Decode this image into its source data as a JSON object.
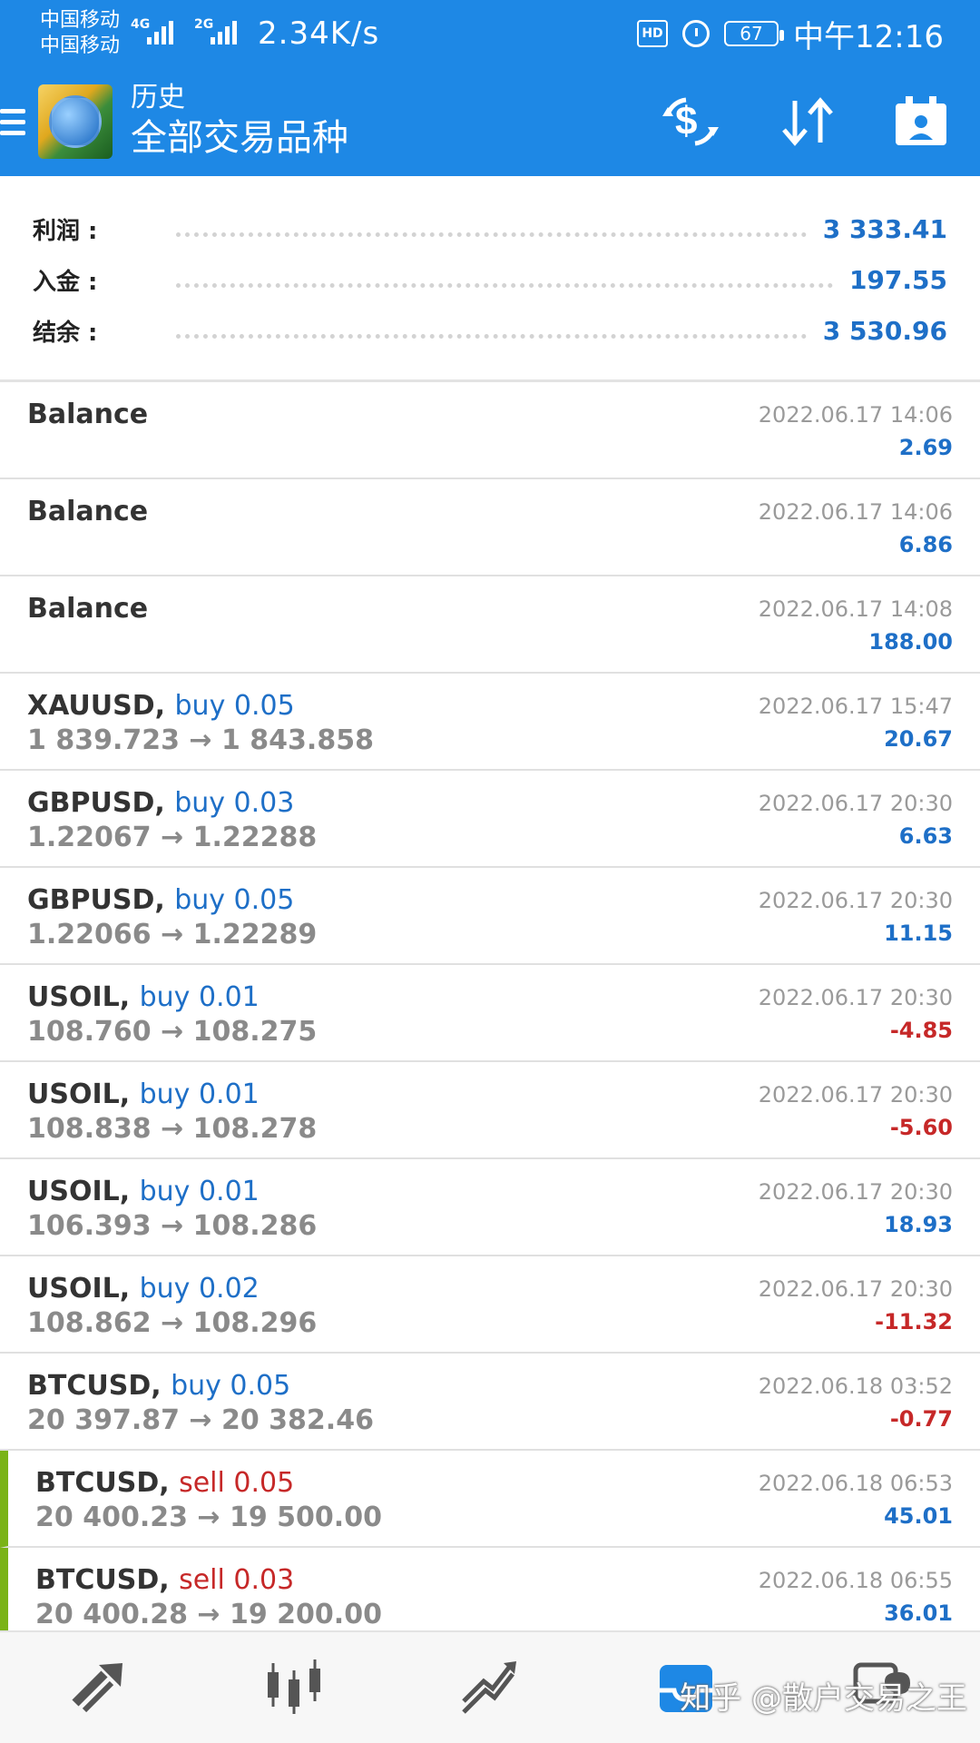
{
  "status_bar": {
    "carrier1": "中国移动",
    "carrier2": "中国移动",
    "sig1_tag": "4G",
    "sig2_tag": "2G",
    "netspeed": "2.34K/s",
    "hd": "HD",
    "battery": "67",
    "time": "中午12:16"
  },
  "appbar": {
    "subtitle": "历史",
    "title": "全部交易品种"
  },
  "summary": {
    "rows": [
      {
        "label": "利润 :",
        "value": "3 333.41"
      },
      {
        "label": "入金 :",
        "value": "197.55"
      },
      {
        "label": "结余 :",
        "value": "3 530.96"
      }
    ]
  },
  "deals": [
    {
      "symbol": "Balance",
      "side": "",
      "prices": "",
      "date": "2022.06.17 14:06",
      "profit": "2.69",
      "sign": "pos",
      "accent": false
    },
    {
      "symbol": "Balance",
      "side": "",
      "prices": "",
      "date": "2022.06.17 14:06",
      "profit": "6.86",
      "sign": "pos",
      "accent": false
    },
    {
      "symbol": "Balance",
      "side": "",
      "prices": "",
      "date": "2022.06.17 14:08",
      "profit": "188.00",
      "sign": "pos",
      "accent": false
    },
    {
      "symbol": "XAUUSD,",
      "side": "buy 0.05",
      "side_type": "buy",
      "prices": "1 839.723 → 1 843.858",
      "date": "2022.06.17 15:47",
      "profit": "20.67",
      "sign": "pos",
      "accent": false
    },
    {
      "symbol": "GBPUSD,",
      "side": "buy 0.03",
      "side_type": "buy",
      "prices": "1.22067 → 1.22288",
      "date": "2022.06.17 20:30",
      "profit": "6.63",
      "sign": "pos",
      "accent": false
    },
    {
      "symbol": "GBPUSD,",
      "side": "buy 0.05",
      "side_type": "buy",
      "prices": "1.22066 → 1.22289",
      "date": "2022.06.17 20:30",
      "profit": "11.15",
      "sign": "pos",
      "accent": false
    },
    {
      "symbol": "USOIL,",
      "side": "buy 0.01",
      "side_type": "buy",
      "prices": "108.760 → 108.275",
      "date": "2022.06.17 20:30",
      "profit": "-4.85",
      "sign": "neg",
      "accent": false
    },
    {
      "symbol": "USOIL,",
      "side": "buy 0.01",
      "side_type": "buy",
      "prices": "108.838 → 108.278",
      "date": "2022.06.17 20:30",
      "profit": "-5.60",
      "sign": "neg",
      "accent": false
    },
    {
      "symbol": "USOIL,",
      "side": "buy 0.01",
      "side_type": "buy",
      "prices": "106.393 → 108.286",
      "date": "2022.06.17 20:30",
      "profit": "18.93",
      "sign": "pos",
      "accent": false
    },
    {
      "symbol": "USOIL,",
      "side": "buy 0.02",
      "side_type": "buy",
      "prices": "108.862 → 108.296",
      "date": "2022.06.17 20:30",
      "profit": "-11.32",
      "sign": "neg",
      "accent": false
    },
    {
      "symbol": "BTCUSD,",
      "side": "buy 0.05",
      "side_type": "buy",
      "prices": "20 397.87 → 20 382.46",
      "date": "2022.06.18 03:52",
      "profit": "-0.77",
      "sign": "neg",
      "accent": false
    },
    {
      "symbol": "BTCUSD,",
      "side": "sell 0.05",
      "side_type": "sell",
      "prices": "20 400.23 → 19 500.00",
      "date": "2022.06.18 06:53",
      "profit": "45.01",
      "sign": "pos",
      "accent": true
    },
    {
      "symbol": "BTCUSD,",
      "side": "sell 0.03",
      "side_type": "sell",
      "prices": "20 400.28 → 19 200.00",
      "date": "2022.06.18 06:55",
      "profit": "36.01",
      "sign": "pos",
      "accent": true
    }
  ],
  "bottom_nav": {
    "items": [
      "quotes-icon",
      "chart-icon",
      "trade-icon",
      "history-icon",
      "messages-icon"
    ],
    "active_index": 3
  },
  "watermark": "知乎 @散户交易之王",
  "colors": {
    "primary": "#1e88e5",
    "positive": "#1e6fc7",
    "negative": "#c62828",
    "accent_bar": "#7ab317"
  }
}
